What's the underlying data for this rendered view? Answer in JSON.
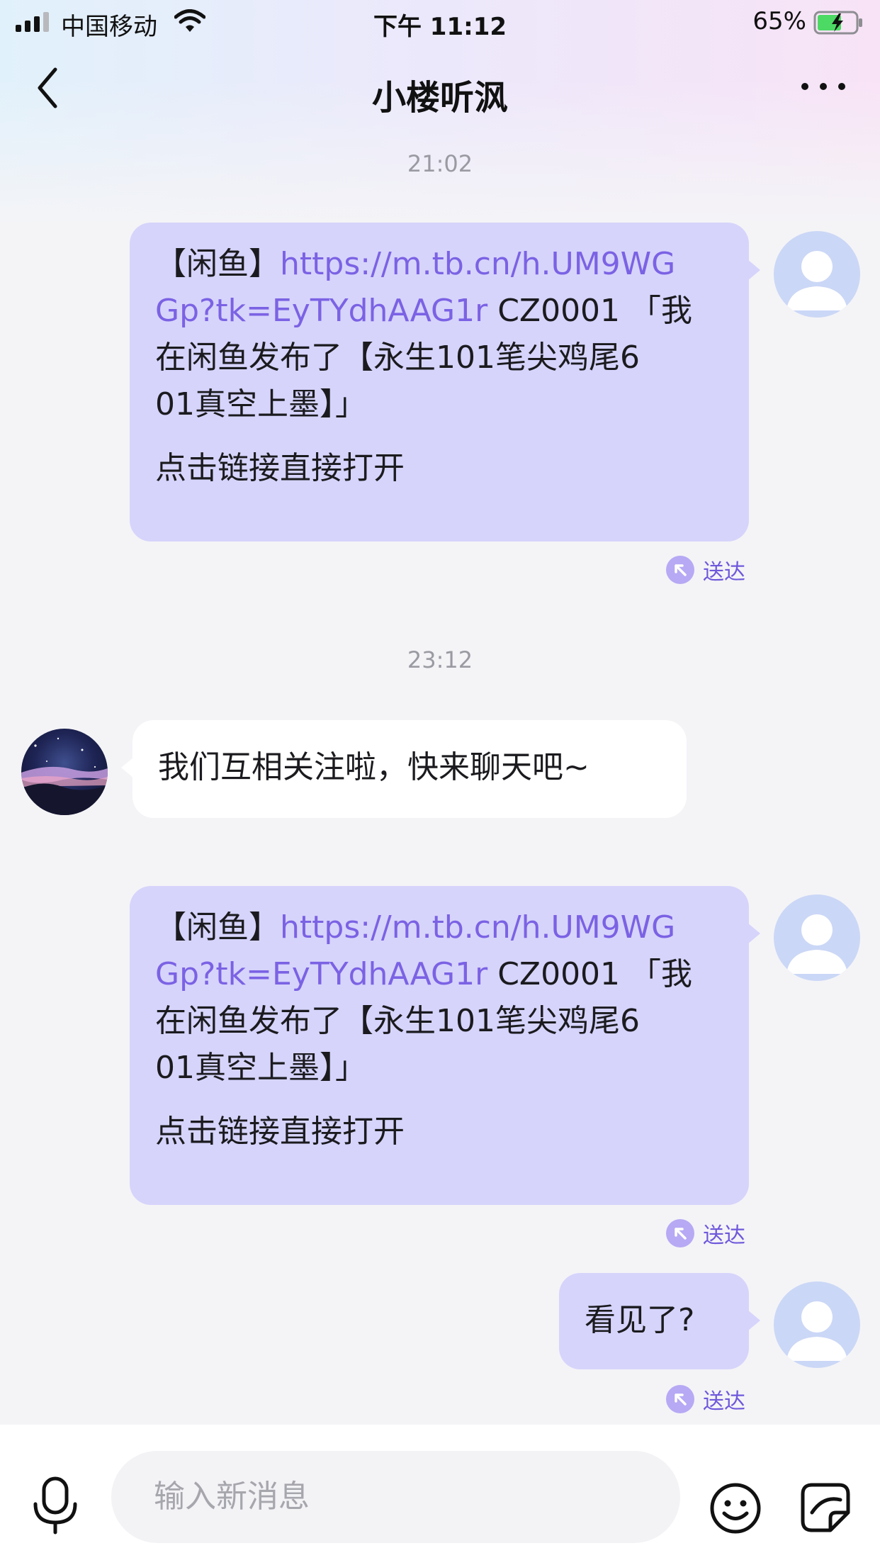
{
  "status_bar": {
    "carrier": "中国移动",
    "time": "下午 11:12",
    "battery": "65%"
  },
  "header": {
    "title": "小楼听沨"
  },
  "messages": [
    {
      "time": "21:02",
      "direction": "outgoing",
      "prefix": "【闲鱼】",
      "link": "https://m.tb.cn/h.UM9WGGp?tk=EyTYdhAAG1r",
      "link_line1": "https://m.tb.cn/h.UM9WG",
      "link_line2": "Gp?tk=EyTYdhAAG1r",
      "body_line2_rest": " CZ0001 「我",
      "body_line3": "在闲鱼发布了【永生101笔尖鸡尾6",
      "body_line4": "01真空上墨】」",
      "footer": "点击链接直接打开",
      "status": "送达"
    },
    {
      "time": "23:12",
      "direction": "incoming",
      "text": "我们互相关注啦，快来聊天吧~"
    },
    {
      "direction": "outgoing",
      "prefix": "【闲鱼】",
      "link": "https://m.tb.cn/h.UM9WGGp?tk=EyTYdhAAG1r",
      "link_line1": "https://m.tb.cn/h.UM9WG",
      "link_line2": "Gp?tk=EyTYdhAAG1r",
      "body_line2_rest": " CZ0001 「我",
      "body_line3": "在闲鱼发布了【永生101笔尖鸡尾6",
      "body_line4": "01真空上墨】」",
      "footer": "点击链接直接打开",
      "status": "送达"
    },
    {
      "direction": "outgoing",
      "text": "看见了?",
      "status": "送达"
    }
  ],
  "input_bar": {
    "placeholder": "输入新消息",
    "icons": [
      "microphone-icon",
      "emoji-icon",
      "sticker-icon"
    ]
  },
  "colors": {
    "outgoing_bubble": "#d6d4fb",
    "incoming_bubble": "#ffffff",
    "link": "#7b62e4",
    "status": "#6f58db"
  }
}
